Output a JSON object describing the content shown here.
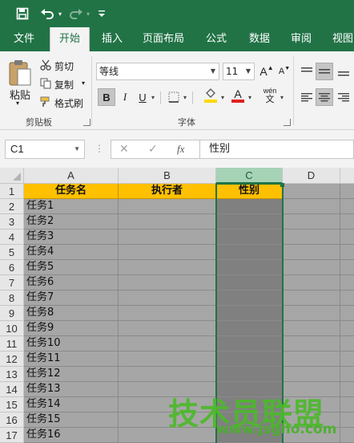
{
  "quick_access": {
    "save_icon": "save-icon",
    "undo_icon": "undo-icon",
    "redo_icon": "redo-icon",
    "customize_icon": "customize-qat-icon"
  },
  "tabs": [
    "文件",
    "开始",
    "插入",
    "页面布局",
    "公式",
    "数据",
    "审阅",
    "视图"
  ],
  "active_tab": "开始",
  "ribbon": {
    "clipboard": {
      "paste": "粘贴",
      "cut": "剪切",
      "copy": "复制",
      "format_painter": "格式刷",
      "group_label": "剪贴板"
    },
    "font": {
      "font_name": "等线",
      "font_size": "11",
      "bold": "B",
      "italic": "I",
      "underline": "U",
      "wen": "wén",
      "wen_char": "文",
      "font_color_letter": "A",
      "group_label": "字体"
    },
    "colors": {
      "fill_highlight": "#ffd800",
      "font_color": "#e02020"
    }
  },
  "formula_bar": {
    "name_box": "C1",
    "fx": "fx",
    "value": "性别"
  },
  "sheet": {
    "columns": [
      "A",
      "B",
      "C",
      "D"
    ],
    "selected_column": "C",
    "rows": [
      "1",
      "2",
      "3",
      "4",
      "5",
      "6",
      "7",
      "8",
      "9",
      "10",
      "11",
      "12",
      "13",
      "14",
      "15",
      "16",
      "17"
    ],
    "header_row": [
      "任务名",
      "执行者",
      "性别"
    ],
    "tasks": [
      "任务1",
      "任务2",
      "任务3",
      "任务4",
      "任务5",
      "任务6",
      "任务7",
      "任务8",
      "任务9",
      "任务10",
      "任务11",
      "任务12",
      "任务13",
      "任务14",
      "任务15",
      "任务16"
    ],
    "colors": {
      "header_fill": "#ffc000",
      "data_fill": "#a6a6a6",
      "selected_fill": "#808080",
      "accent": "#217346"
    }
  },
  "watermark": {
    "brand": "技术员联盟",
    "url": "www.jsgho.com"
  }
}
